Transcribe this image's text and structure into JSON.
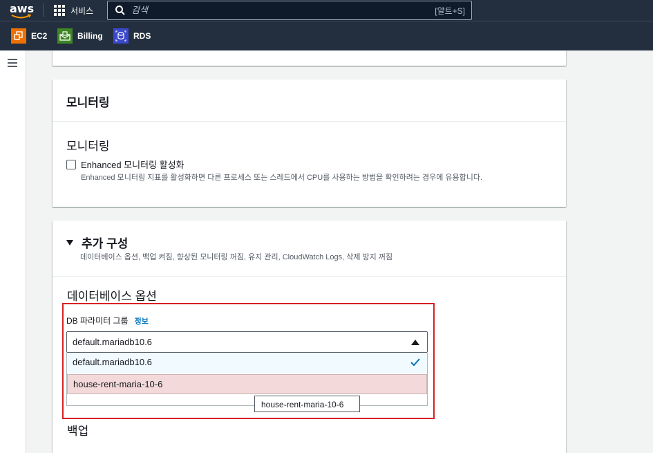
{
  "topbar": {
    "logo": "aws",
    "services_label": "서비스",
    "search_placeholder": "검색",
    "search_shortcut": "[알트+S]"
  },
  "favorites": [
    {
      "label": "EC2",
      "color": "#ed7100"
    },
    {
      "label": "Billing",
      "color": "#3f8624"
    },
    {
      "label": "RDS",
      "color": "#3b48cc"
    }
  ],
  "monitoring_panel": {
    "header": "모니터링",
    "subheader": "모니터링",
    "checkbox_label": "Enhanced 모니터링 활성화",
    "checkbox_checked": false,
    "checkbox_desc": "Enhanced 모니터링 지표를 활성화하면 다른 프로세스 또는 스레드에서 CPU를 사용하는 방법을 확인하려는 경우에 유용합니다."
  },
  "additional_config": {
    "title": "추가 구성",
    "desc": "데이터베이스 옵션, 백업 켜짐, 향상된 모니터링 꺼짐, 유지 관리, CloudWatch Logs, 삭제 방지 꺼짐",
    "db_options_heading": "데이터베이스 옵션",
    "param_group_label": "DB 파라미터 그룹",
    "info_link": "정보",
    "selected_value": "default.mariadb10.6",
    "options": [
      "default.mariadb10.6",
      "house-rent-maria-10-6"
    ],
    "tooltip": "house-rent-maria-10-6",
    "backup_heading": "백업"
  },
  "colors": {
    "topbar": "#232f3e",
    "highlight_border": "#d91f26",
    "link": "#0073bb",
    "check": "#0073bb"
  }
}
